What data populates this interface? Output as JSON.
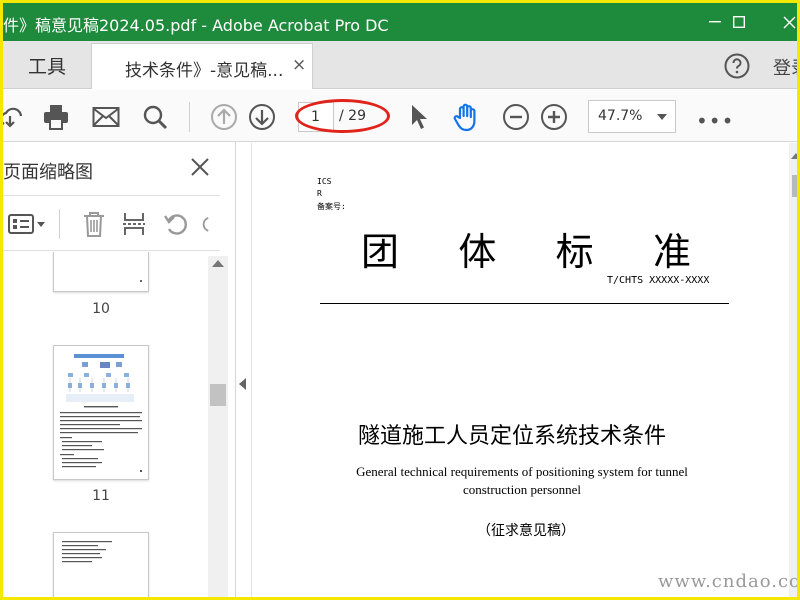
{
  "window": {
    "title": "件》稿意见稿2024.05.pdf - Adobe Acrobat Pro DC",
    "controls": [
      "minimize",
      "maximize",
      "close"
    ]
  },
  "tabs": {
    "tools": "工具",
    "document": "技术条件》-意见稿...",
    "document_close": "×",
    "signin": "登录"
  },
  "toolbar": {
    "page_current": "1",
    "page_total": "/ 29",
    "zoom": "47.7%",
    "more": "•••",
    "highlight_color": "#e0241b"
  },
  "left_pane": {
    "title": "页面缩略图",
    "thumbnails": [
      {
        "number": "10"
      },
      {
        "number": "11"
      },
      {
        "number": ""
      }
    ]
  },
  "document": {
    "meta": [
      "ICS",
      "R",
      "备案号:"
    ],
    "title_chars": [
      "团",
      "体",
      "标",
      "准"
    ],
    "standard_no": "T/CHTS   XXXXX-XXXX",
    "title_zh": "隧道施工人员定位系统技术条件",
    "title_en_line1": "General technical requirements of positioning system for tunnel",
    "title_en_line2": "construction personnel",
    "draft_note": "（征求意见稿）"
  },
  "watermark": "www.cndao.com",
  "colors": {
    "titlebar": "#1e8a3c",
    "frame": "#f5e800"
  }
}
